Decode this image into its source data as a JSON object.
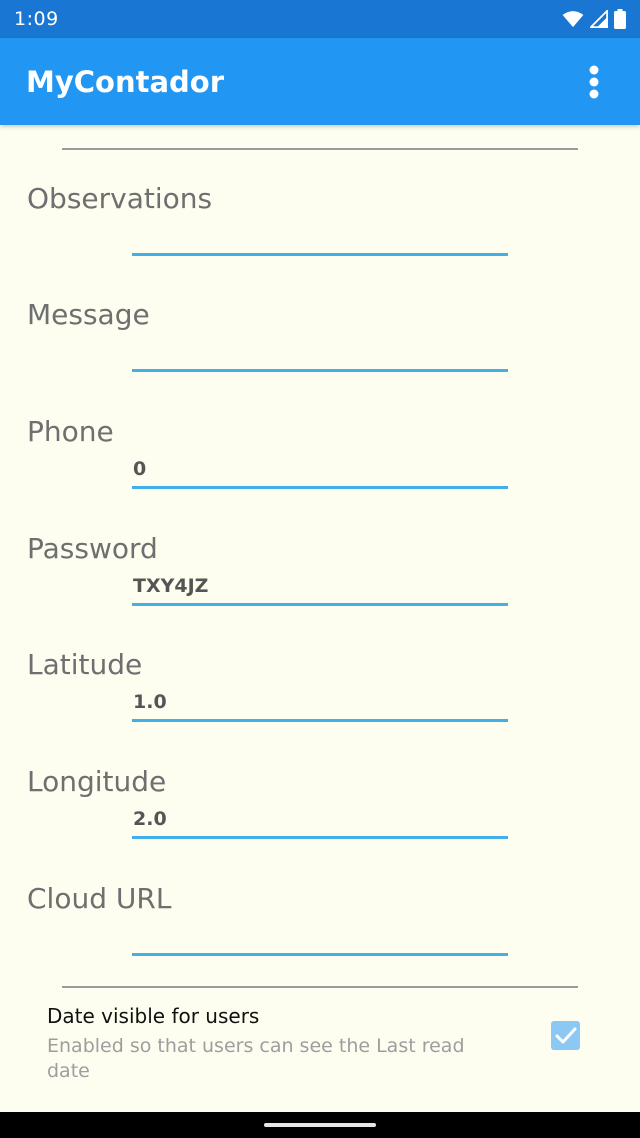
{
  "status_bar": {
    "time": "1:09",
    "icons": [
      "wifi-icon",
      "signal-icon",
      "battery-icon"
    ]
  },
  "app_bar": {
    "title": "MyContador",
    "menu_icon": "more-vert-icon"
  },
  "fields": [
    {
      "label": "Observations",
      "value": ""
    },
    {
      "label": "Message",
      "value": ""
    },
    {
      "label": "Phone",
      "value": "0"
    },
    {
      "label": "Password",
      "value": "TXY4JZ"
    },
    {
      "label": "Latitude",
      "value": "1.0"
    },
    {
      "label": "Longitude",
      "value": "2.0"
    },
    {
      "label": "Cloud URL",
      "value": ""
    }
  ],
  "preference": {
    "title": "Date visible for users",
    "summary": "Enabled so that users can see the Last read date",
    "checked": true
  },
  "colors": {
    "status_bar": "#1976D2",
    "app_bar": "#2196F3",
    "background": "#FDFEF0",
    "input_underline": "#42B0E8",
    "checkbox": "#8CC8F4"
  }
}
